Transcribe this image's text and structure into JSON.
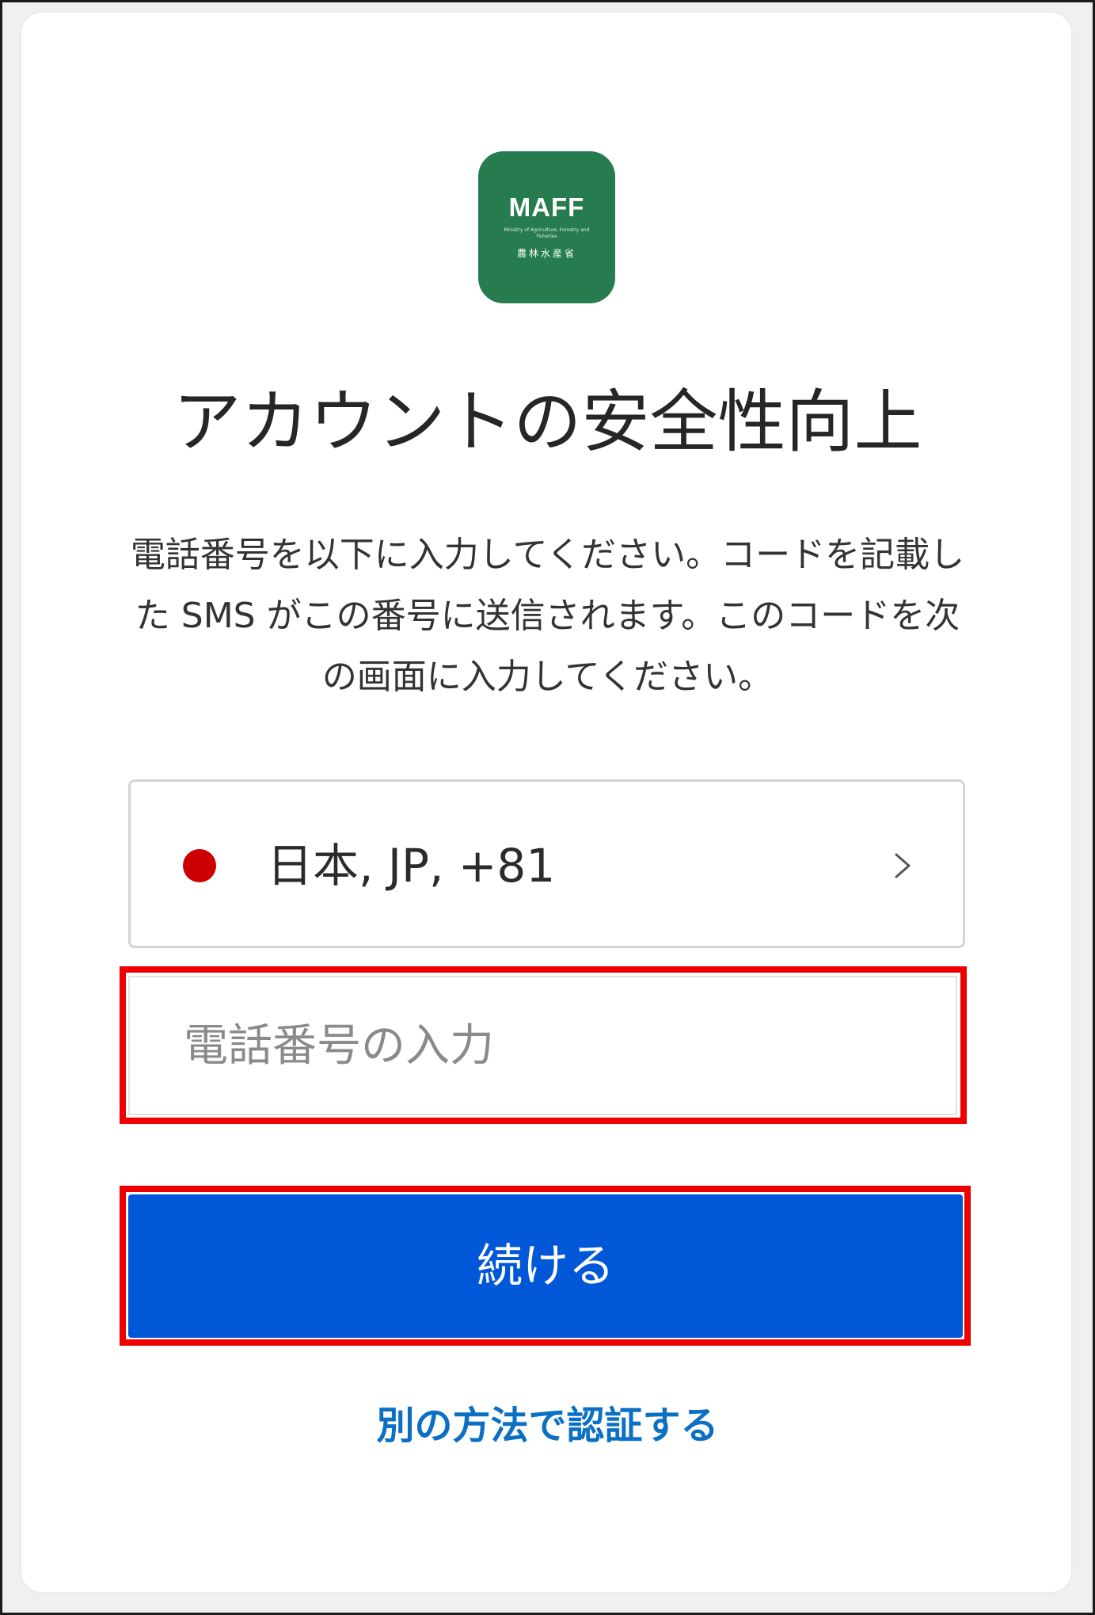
{
  "logo": {
    "text": "MAFF",
    "subtext": "Ministry of Agriculture, Forestry and Fisheries",
    "text_jp": "農林水産省",
    "color": "#267c4f"
  },
  "title": "アカウントの安全性向上",
  "description": "電話番号を以下に入力してください。コードを記載した SMS がこの番号に送信されます。このコードを次の画面に入力してください。",
  "country": {
    "label": "日本, JP, +81",
    "flag_color": "#cc0000",
    "icon": "chevron-right-icon"
  },
  "phone_input": {
    "value": "",
    "placeholder": "電話番号の入力"
  },
  "continue_button": {
    "label": "続ける",
    "color": "#0057d8"
  },
  "alt_link": {
    "label": "別の方法で認証する",
    "color": "#0b6fc4"
  },
  "highlight_color": "#ee0000"
}
